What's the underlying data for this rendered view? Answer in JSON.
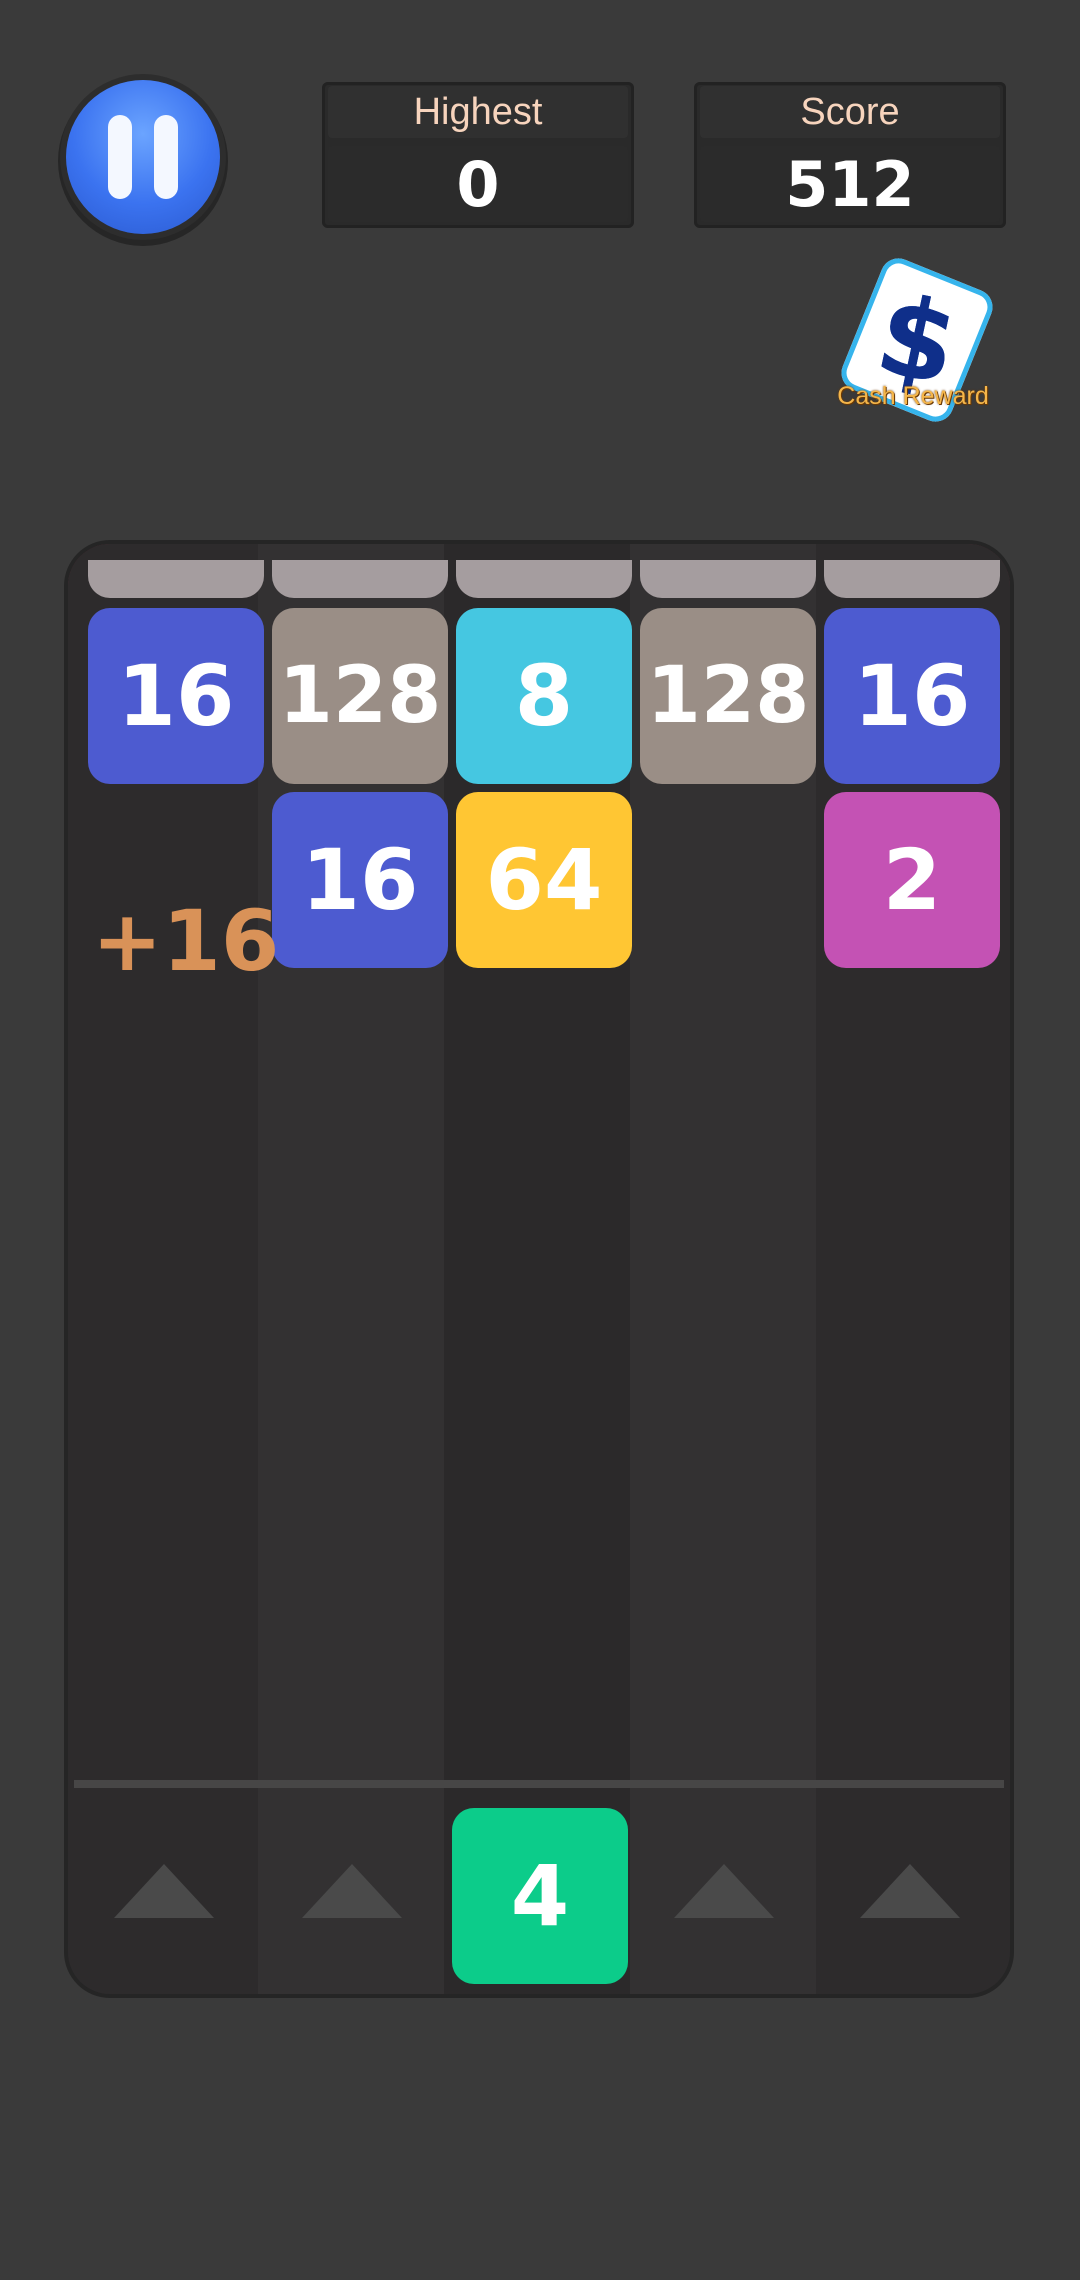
{
  "hud": {
    "highest_label": "Highest",
    "highest_value": "0",
    "score_label": "Score",
    "score_value": "512"
  },
  "cash_reward": {
    "label": "Cash Reward",
    "icon": "dollar-card-icon",
    "symbol": "$"
  },
  "board": {
    "row1": [
      "16",
      "128",
      "8",
      "128",
      "16"
    ],
    "row2": [
      "16",
      "64",
      "2"
    ],
    "floating_points": "+16",
    "next_tile": "4"
  },
  "colors": {
    "tile_16": "#4d5bd0",
    "tile_128": "#9a8e86",
    "tile_8": "#45c7e1",
    "tile_64": "#ffc633",
    "tile_2": "#c452b4",
    "tile_4": "#0ccc8a",
    "pause_button": "#3b73f0"
  }
}
